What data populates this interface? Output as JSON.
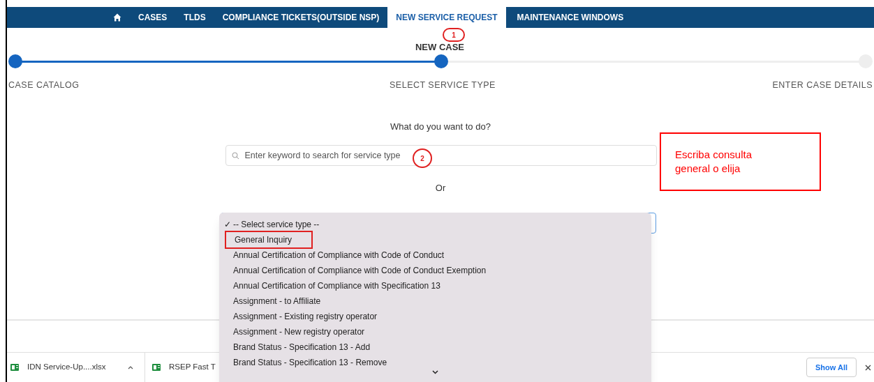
{
  "nav": {
    "tabs": [
      {
        "label": "CASES",
        "selected": false
      },
      {
        "label": "TLDS",
        "selected": false
      },
      {
        "label": "COMPLIANCE TICKETS(OUTSIDE NSP)",
        "selected": false
      },
      {
        "label": "NEW SERVICE REQUEST",
        "selected": true
      },
      {
        "label": "MAINTENANCE WINDOWS",
        "selected": false
      }
    ]
  },
  "stepper": {
    "title": "NEW CASE",
    "steps": [
      {
        "label": "CASE CATALOG",
        "reached": true
      },
      {
        "label": "SELECT SERVICE TYPE",
        "reached": true
      },
      {
        "label": "ENTER CASE DETAILS",
        "reached": false
      }
    ]
  },
  "form": {
    "prompt": "What do you want to do?",
    "search": {
      "placeholder": "Enter keyword to search for service type"
    },
    "or_label": "Or",
    "dropdown": {
      "check_glyph": "✓",
      "options": [
        {
          "label": "-- Select service type --",
          "selected": true,
          "annotated": false
        },
        {
          "label": "General Inquiry",
          "selected": false,
          "annotated": true
        },
        {
          "label": "Annual Certification of Compliance with Code of Conduct",
          "selected": false,
          "annotated": false
        },
        {
          "label": "Annual Certification of Compliance with Code of Conduct Exemption",
          "selected": false,
          "annotated": false
        },
        {
          "label": "Annual Certification of Compliance with Specification 13",
          "selected": false,
          "annotated": false
        },
        {
          "label": "Assignment - to Affiliate",
          "selected": false,
          "annotated": false
        },
        {
          "label": "Assignment - Existing registry operator",
          "selected": false,
          "annotated": false
        },
        {
          "label": "Assignment - New registry operator",
          "selected": false,
          "annotated": false
        },
        {
          "label": "Brand Status - Specification 13 - Add",
          "selected": false,
          "annotated": false
        },
        {
          "label": "Brand Status - Specification 13 - Remove",
          "selected": false,
          "annotated": false
        }
      ]
    }
  },
  "annotations": {
    "markers": [
      "1",
      "2"
    ],
    "callout": "Escriba consulta general o elija"
  },
  "downloads": {
    "items": [
      {
        "name": "IDN Service-Up....xlsx"
      },
      {
        "name": "RSEP Fast T"
      }
    ],
    "show_all": "Show All"
  }
}
